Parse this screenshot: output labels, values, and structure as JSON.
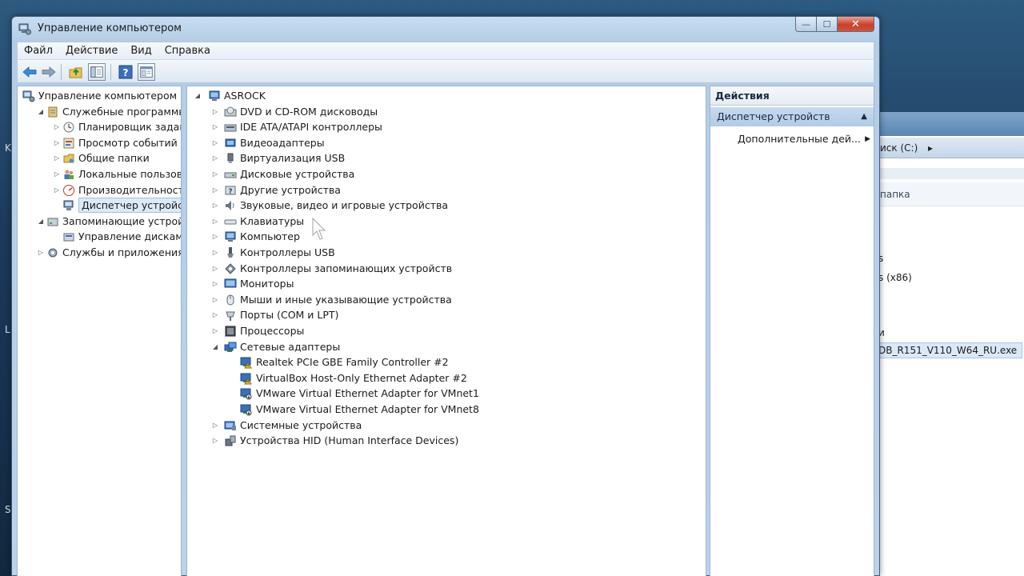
{
  "desktop": {
    "edge_letters": [
      "K",
      "L",
      "S"
    ]
  },
  "background_window": {
    "address_text": "иск (C:)",
    "column_header": "папка",
    "files": [
      "s",
      "s (x86)",
      "",
      "",
      "и",
      "DB_R151_V110_W64_RU.exe"
    ]
  },
  "window": {
    "title": "Управление компьютером",
    "controls": {
      "minimize": "—",
      "maximize": "☐",
      "close": "✕"
    }
  },
  "menu": [
    "Файл",
    "Действие",
    "Вид",
    "Справка"
  ],
  "toolbar": [
    "back-arrow-icon",
    "forward-arrow-icon",
    "up-folder-icon",
    "show-hide-tree-icon",
    "help-icon",
    "properties-icon"
  ],
  "left_tree": [
    {
      "label": "Управление компьютером (л",
      "level": 0,
      "expander": "",
      "icon": "computer-management-icon"
    },
    {
      "label": "Служебные программы",
      "level": 1,
      "expander": "◢",
      "icon": "tools-icon"
    },
    {
      "label": "Планировщик заданий",
      "level": 2,
      "expander": "▷",
      "icon": "clock-icon"
    },
    {
      "label": "Просмотр событий",
      "level": 2,
      "expander": "▷",
      "icon": "event-viewer-icon"
    },
    {
      "label": "Общие папки",
      "level": 2,
      "expander": "▷",
      "icon": "shared-folder-icon"
    },
    {
      "label": "Локальные пользовате",
      "level": 2,
      "expander": "▷",
      "icon": "users-icon"
    },
    {
      "label": "Производительность",
      "level": 2,
      "expander": "▷",
      "icon": "performance-icon"
    },
    {
      "label": "Диспетчер устройств",
      "level": 2,
      "expander": "",
      "icon": "device-manager-icon",
      "selected": true
    },
    {
      "label": "Запоминающие устройст",
      "level": 1,
      "expander": "◢",
      "icon": "storage-icon"
    },
    {
      "label": "Управление дисками",
      "level": 2,
      "expander": "",
      "icon": "disk-management-icon"
    },
    {
      "label": "Службы и приложения",
      "level": 1,
      "expander": "▷",
      "icon": "services-icon"
    }
  ],
  "device_tree": {
    "root": "ASROCK",
    "categories": [
      {
        "label": "DVD и CD-ROM дисководы",
        "icon": "dvd-drive-icon"
      },
      {
        "label": "IDE ATA/ATAPI контроллеры",
        "icon": "ide-controller-icon"
      },
      {
        "label": "Видеоадаптеры",
        "icon": "display-adapter-icon"
      },
      {
        "label": "Виртуализация USB",
        "icon": "usb-virtualization-icon"
      },
      {
        "label": "Дисковые устройства",
        "icon": "disk-drive-icon"
      },
      {
        "label": "Другие устройства",
        "icon": "other-devices-icon"
      },
      {
        "label": "Звуковые, видео и игровые устройства",
        "icon": "speaker-icon"
      },
      {
        "label": "Клавиатуры",
        "icon": "keyboard-icon"
      },
      {
        "label": "Компьютер",
        "icon": "computer-icon"
      },
      {
        "label": "Контроллеры USB",
        "icon": "usb-icon"
      },
      {
        "label": "Контроллеры запоминающих устройств",
        "icon": "storage-controller-icon"
      },
      {
        "label": "Мониторы",
        "icon": "monitor-icon"
      },
      {
        "label": "Мыши и иные указывающие устройства",
        "icon": "mouse-icon"
      },
      {
        "label": "Порты (COM и LPT)",
        "icon": "port-icon"
      },
      {
        "label": "Процессоры",
        "icon": "processor-icon"
      },
      {
        "label": "Сетевые адаптеры",
        "icon": "network-adapter-icon",
        "expanded": true,
        "children": [
          {
            "label": "Realtek PCIe GBE Family Controller #2",
            "icon": "network-warning-icon"
          },
          {
            "label": "VirtualBox Host-Only Ethernet Adapter #2",
            "icon": "network-warning-icon"
          },
          {
            "label": "VMware Virtual Ethernet Adapter for VMnet1",
            "icon": "network-disabled-icon"
          },
          {
            "label": "VMware Virtual Ethernet Adapter for VMnet8",
            "icon": "network-disabled-icon"
          }
        ]
      },
      {
        "label": "Системные устройства",
        "icon": "system-devices-icon"
      },
      {
        "label": "Устройства HID (Human Interface Devices)",
        "icon": "hid-icon"
      }
    ]
  },
  "actions": {
    "header": "Действия",
    "section": "Диспетчер устройств",
    "item": "Дополнительные дей..."
  }
}
